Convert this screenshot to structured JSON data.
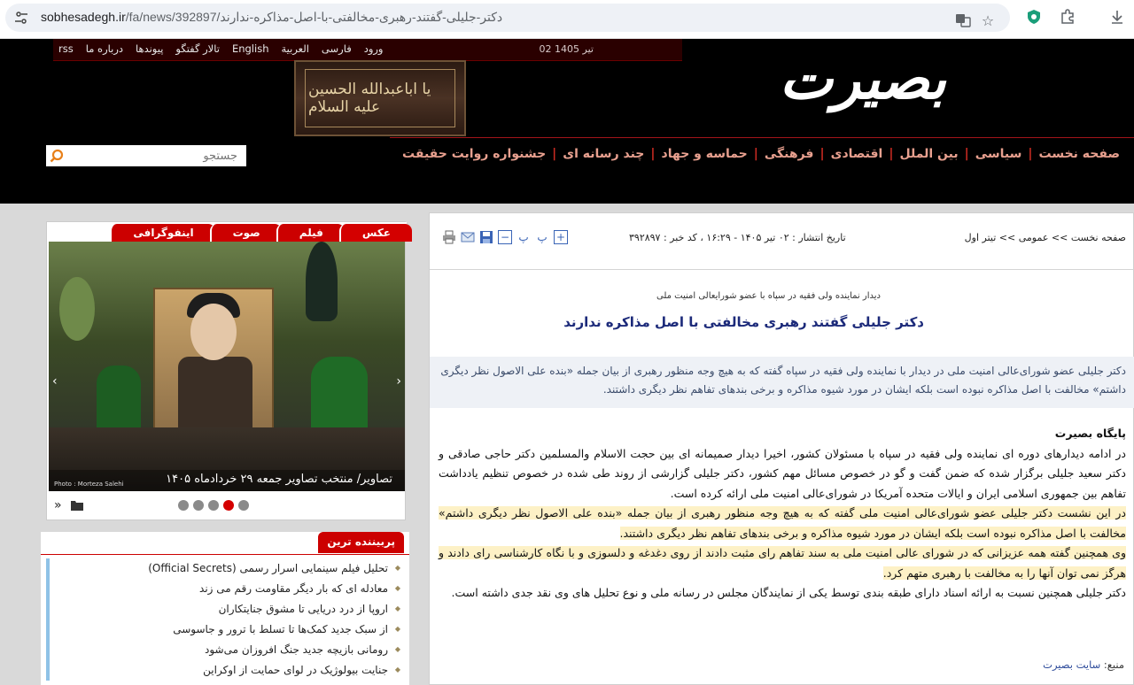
{
  "browser": {
    "url_domain": "sobhesadegh.ir",
    "url_path": "/fa/news/392897/دکتر-جلیلی-گفتند-رهبری-مخالفتی-با-اصل-مذاکره-ندارند"
  },
  "header": {
    "date": "02 تیر 1405",
    "toplinks": [
      "rss",
      "درباره ما",
      "پیوندها",
      "تالار گفتگو",
      "English",
      "العربية",
      "فارسی",
      "ورود"
    ],
    "banner_text": "یا اباعبدالله الحسین علیه السلام",
    "logo": "بصیرت",
    "search_placeholder": "جستجو",
    "nav": [
      "صفحه نخست",
      "سیاسی",
      "بین الملل",
      "اقتصادی",
      "فرهنگی",
      "حماسه و جهاد",
      "چند رسانه ای",
      "جشنواره روایت حقیقت"
    ]
  },
  "article": {
    "breadcrumb": "صفحه نخست >> عمومی >> تیتر اول",
    "pubinfo": "تاریخ انتشار : ۰۲ تیر ۱۴۰۵ - ۱۶:۲۹ ، کد خبر : ۳۹۲۸۹۷",
    "lead": "دیدار نماینده ولی فقیه در سپاه با عضو شورایعالی امنیت ملی",
    "headline": "دکتر جلیلی گفتند رهبری مخالفتی با اصل مذاکره ندارند",
    "summary": "دکتر جلیلی عضو شورای‌عالی امنیت ملی در دیدار با نماینده ولی فقیه در سپاه گفته که به هیچ وجه منظور رهبری از بیان جمله «بنده علی الاصول نظر دیگری داشتم» مخالفت با اصل مذاکره نبوده است بلکه ایشان در مورد شیوه مذاکره و برخی بندهای تفاهم نظر دیگری داشتند.",
    "kicker": "پایگاه بصیرت",
    "para1": "در ادامه دیدارهای دوره ای نماینده ولی فقیه در سپاه با مسئولان کشور، اخیرا دیدار صمیمانه ای بین حجت الاسلام والمسلمین دکتر حاجی صادقی و دکتر سعید جلیلی برگزار شده که ضمن گفت و گو در خصوص مسائل مهم کشور، دکتر جلیلی گزارشی از روند طی شده در خصوص تنظیم یادداشت تفاهم بین جمهوری اسلامی ایران و ایالات متحده آمریکا در شورای‌عالی امنیت ملی ارائه کرده است.",
    "para2": "در این نشست دکتر جلیلی عضو شورای‌عالی امنیت ملی گفته که به هیچ وجه منظور رهبری از بیان جمله «بنده علی الاصول نظر دیگری داشتم» مخالفت با اصل مذاکره نبوده است بلکه ایشان در مورد شیوه مذاکره و برخی بندهای تفاهم نظر دیگری داشتند.",
    "para3": "وی همچنین گفته همه عزیزانی که در شورای عالی امنیت ملی به سند تفاهم رای مثبت دادند از روی دغدغه و دلسوزی و با نگاه کارشناسی رای دادند و هرگز نمی توان آنها را به مخالفت با رهبری متهم کرد.",
    "para4": "دکتر جلیلی همچنین نسبت به ارائه اسناد دارای طبقه بندی توسط یکی از نمایندگان مجلس در رسانه ملی و نوع تحلیل های وی نقد جدی داشته است.",
    "source_label": "منبع:",
    "source_value": "سایت بصیرت"
  },
  "media": {
    "tabs": [
      "عکس",
      "فیلم",
      "صوت",
      "اینفوگرافی"
    ],
    "active_tab": "عکس",
    "caption": "تصاویر/ منتخب تصاویر جمعه ۲۹ خردادماه ۱۴۰۵",
    "credit": "Photo : Morteza Salehi",
    "slides": 5,
    "active_slide": 2
  },
  "popular": {
    "title": "پربیننده ترین",
    "items": [
      "تحلیل فیلم سینمایی اسرار رسمی (Official Secrets)",
      "معادله ای که بار دیگر مقاومت رقم می زند",
      "اروپا از درد دریایی تا مشوق جنایتکاران",
      "از سبک جدید کمک‌ها تا تسلط با ترور و جاسوسی",
      "رومانی بازیچه جدید جنگ افروزان می‌شود",
      "جنایت بیولوژیک در لوای حمایت از اوکراین"
    ]
  },
  "colors": {
    "brand_red": "#c00000",
    "headline_blue": "#1c2a7a",
    "highlight": "#fdf1c6"
  }
}
